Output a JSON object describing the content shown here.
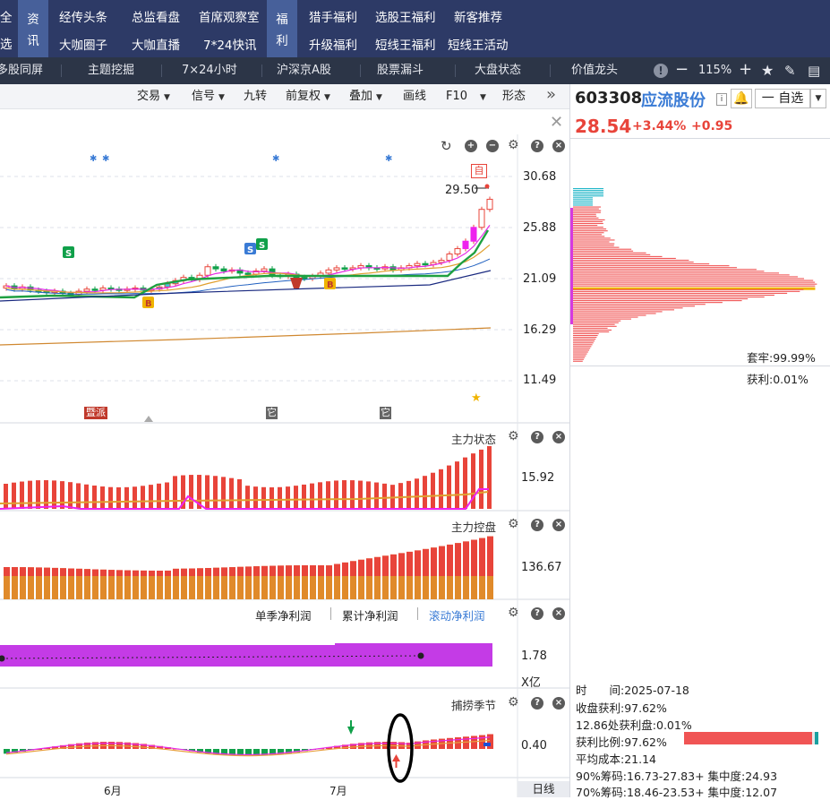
{
  "nav": {
    "left_top": "全",
    "left_bottom": "选",
    "block1_top": "资",
    "block1_bottom": "讯",
    "row1": [
      "经传头条",
      "总监看盘",
      "首席观察室"
    ],
    "row2": [
      "大咖圈子",
      "大咖直播",
      "7*24快讯"
    ],
    "block2_top": "福",
    "block2_bottom": "利",
    "row1b": [
      "猎手福利",
      "选股王福利",
      "新客推荐"
    ],
    "row2b": [
      "升级福利",
      "短线王福利",
      "短线王活动"
    ]
  },
  "tabs": [
    "多股同屏",
    "主题挖掘",
    "7×24小时",
    "沪深京A股",
    "股票漏斗",
    "大盘状态",
    "价值龙头"
  ],
  "tabs_right": {
    "zoom": "115%"
  },
  "toolbar": [
    "交易",
    "信号",
    "九转",
    "前复权",
    "叠加",
    "画线",
    "F10",
    "形态"
  ],
  "stock": {
    "code": "603308",
    "name": "应流股份",
    "price": "28.54",
    "pct": "+3.44%",
    "chg": "+0.95",
    "watch_label": "一 自选"
  },
  "main_chart": {
    "price_label": "29.50",
    "zi_tag": "自",
    "axis": [
      "30.68",
      "25.88",
      "21.09",
      "16.29",
      "11.49"
    ],
    "markers": [
      "暨派",
      "它",
      "它"
    ]
  },
  "panels": [
    {
      "title": "主力状态",
      "axis": "15.92"
    },
    {
      "title": "主力控盘",
      "axis": "136.67"
    },
    {
      "title": "",
      "axis": "1.78",
      "unit": "X亿",
      "legend": [
        "单季净利润",
        "累计净利润",
        "滚动净利润"
      ]
    },
    {
      "title": "捕捞季节",
      "axis": "0.40"
    }
  ],
  "xaxis": [
    "6月",
    "7月"
  ],
  "period": "日线",
  "chips": {
    "tao_lao": "套牢:99.99%",
    "huo_li": "获利:0.01%",
    "time": "时　　间:2025-07-18",
    "close_profit": "收盘获利:97.62%",
    "profit_at": "12.86处获利盘:0.01%",
    "profit_ratio": "获利比例:97.62%",
    "avg_cost": "平均成本:21.14",
    "c90": "90%筹码:16.73-27.83+ 集中度:24.93",
    "c70": "70%筹码:18.46-23.53+ 集中度:12.07",
    "profit_ratio_value": 0.9762
  },
  "colors": {
    "nav_bg": "#2d3a66",
    "up": "#e8443a",
    "down": "#10a04a",
    "accent_blue": "#3a7bd5",
    "magenta": "#e629e6"
  }
}
